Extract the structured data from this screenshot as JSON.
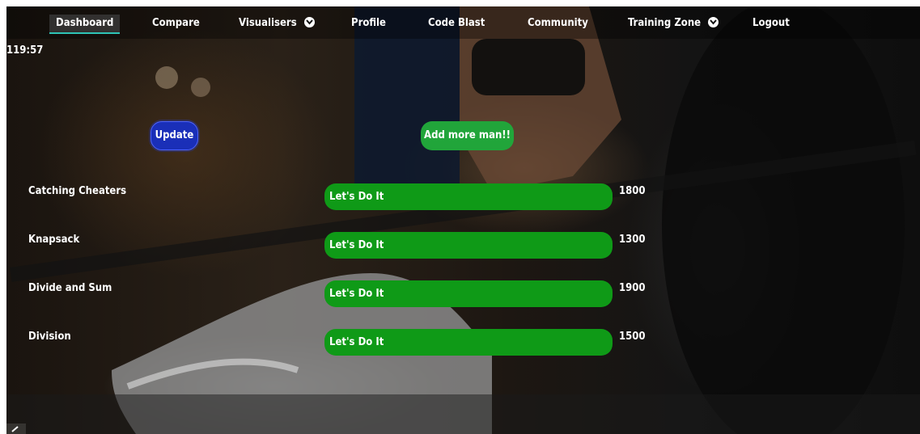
{
  "nav": {
    "items": [
      {
        "label": "Dashboard"
      },
      {
        "label": "Compare"
      },
      {
        "label": "Visualisers"
      },
      {
        "label": "Profile"
      },
      {
        "label": "Code Blast"
      },
      {
        "label": "Community"
      },
      {
        "label": "Training Zone"
      },
      {
        "label": "Logout"
      }
    ]
  },
  "timer": "119:57",
  "actions": {
    "update_label": "Update",
    "add_label": "Add more man!!"
  },
  "problems": [
    {
      "name": "Catching Cheaters",
      "action": "Let's Do It",
      "score": "1800"
    },
    {
      "name": "Knapsack",
      "action": "Let's Do It",
      "score": "1300"
    },
    {
      "name": "Divide and Sum",
      "action": "Let's Do It",
      "score": "1900"
    },
    {
      "name": "Division",
      "action": "Let's Do It",
      "score": "1500"
    }
  ],
  "colors": {
    "active_underline": "#2ec4b6",
    "update_button": "#1a2fb8",
    "add_button": "#21a53a",
    "row_button": "#0f9a17"
  }
}
